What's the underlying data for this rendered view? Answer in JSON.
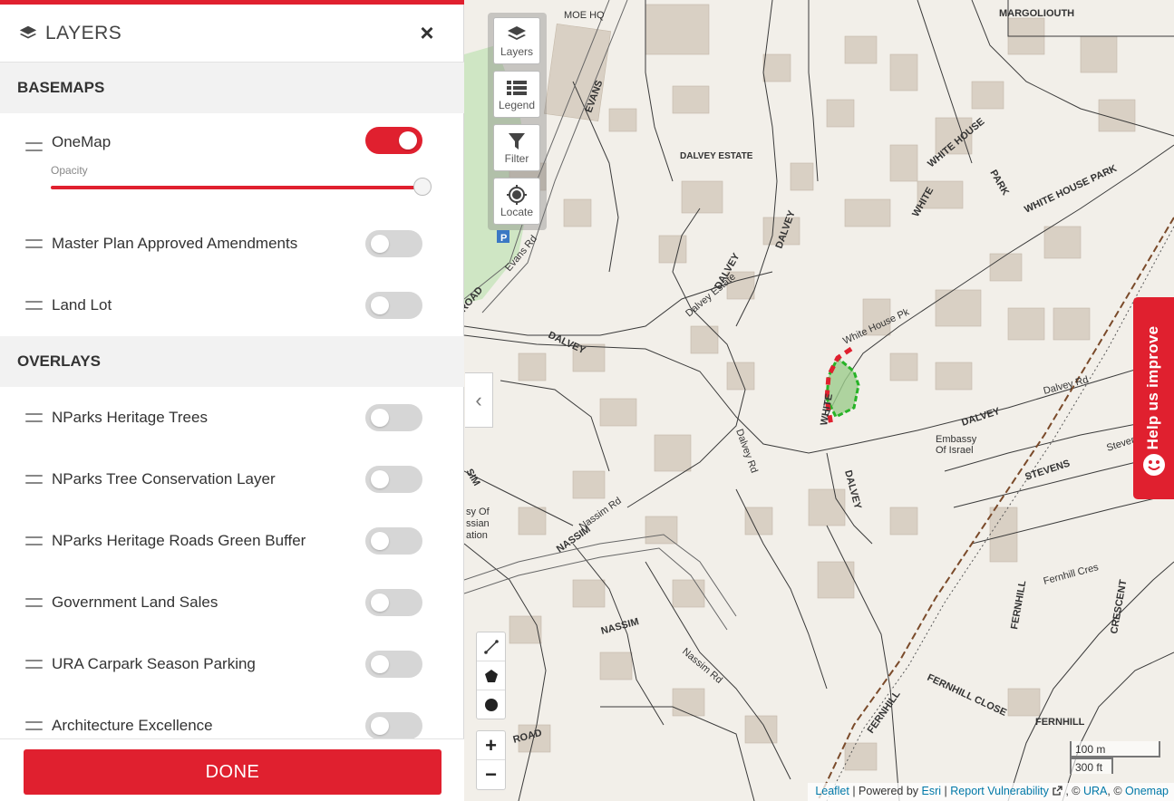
{
  "panel": {
    "title": "LAYERS",
    "close_icon": "×",
    "basemaps_heading": "BASEMAPS",
    "basemaps": [
      {
        "label": "OneMap",
        "enabled": true,
        "opacity_label": "Opacity",
        "opacity": 1.0
      },
      {
        "label": "Master Plan Approved Amendments",
        "enabled": false
      },
      {
        "label": "Land Lot",
        "enabled": false
      }
    ],
    "overlays_heading": "OVERLAYS",
    "overlays": [
      {
        "label": "NParks Heritage Trees",
        "enabled": false
      },
      {
        "label": "NParks Tree Conservation Layer",
        "enabled": false
      },
      {
        "label": "NParks Heritage Roads Green Buffer",
        "enabled": false
      },
      {
        "label": "Government Land Sales",
        "enabled": false
      },
      {
        "label": "URA Carpark Season Parking",
        "enabled": false
      },
      {
        "label": "Architecture Excellence",
        "enabled": false
      }
    ],
    "done_label": "DONE"
  },
  "map_tools": {
    "layers": "Layers",
    "legend": "Legend",
    "filter": "Filter",
    "locate": "Locate"
  },
  "zoom": {
    "in": "+",
    "out": "−"
  },
  "collapse_icon": "‹",
  "help": {
    "label": "Help us improve"
  },
  "scale": {
    "metric": "100 m",
    "imperial": "300 ft"
  },
  "attribution": {
    "leaflet": "Leaflet",
    "sep1": " | Powered by ",
    "esri": "Esri",
    "sep2": " | ",
    "report": "Report Vulnerability",
    "sep3": " , © ",
    "ura": "URA",
    "sep4": ", © ",
    "onemap": "Onemap"
  },
  "map_labels": {
    "margoliouth": "MARGOLIOUTH",
    "evans": "EVANS",
    "evans_rd": "Evans Rd",
    "moe_hq": "MOE HQ",
    "dalvey_estate": "DALVEY ESTATE",
    "dalvey_estate2": "Dalvey Estate",
    "dalvey": "DALVEY",
    "dalvey_rd": "Dalvey Rd",
    "white_house": "WHITE HOUSE",
    "white_house_park": "WHITE HOUSE PARK",
    "white_house_pk": "White House Pk",
    "white": "WHITE",
    "park": "PARK",
    "embassy": "Embassy",
    "of_israel": "Of Israel",
    "stevens": "STEVENS",
    "stevens2": "Stevens",
    "nassim": "NASSIM",
    "nassim_rd": "Nassim Rd",
    "road": "ROAD",
    "fernhill": "FERNHILL",
    "fernhill_cres": "Fernhill Cres",
    "crescent": "CRESCENT",
    "fernhill_close": "FERNHILL CLOSE",
    "sim": "SIM",
    "embassy_frag": "sy Of",
    "russian": "ssian",
    "ation": "ation",
    "parking": "P"
  },
  "colors": {
    "accent": "#e0202f",
    "map_bg": "#f2efe9",
    "building": "#d9d0c4",
    "lot_line": "#444444",
    "selection_fill": "#9ccc8c",
    "selection_edge": "#27b327"
  }
}
